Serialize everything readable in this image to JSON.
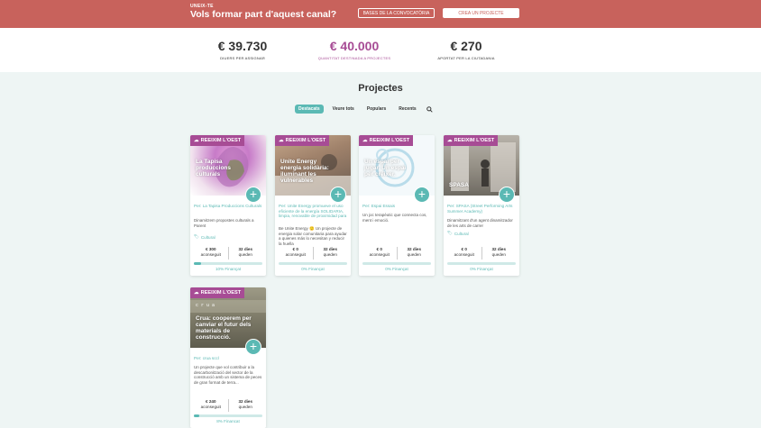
{
  "banner": {
    "eyebrow": "UNEIX-TE",
    "headline": "Vols formar part d'aquest canal?",
    "bases_button": "BASES DE LA CONVOCATÒRIA",
    "create_button": "CREA UN PROJECTE"
  },
  "stats": [
    {
      "value": "€ 39.730",
      "label": "DIUERS PER ASSIGNAR"
    },
    {
      "value": "€ 40.000",
      "label": "QUANTITAT DESTINADA A PROJECTES"
    },
    {
      "value": "€ 270",
      "label": "APORTAT PER LA CIUTADANIA"
    }
  ],
  "colors": {
    "accent": "#5bb9b4",
    "brand_red": "#c8625c",
    "badge_purple": "#a74c95"
  },
  "section_title": "Projectes",
  "tabs": [
    "Destacats",
    "Veure tots",
    "Populars",
    "Recents"
  ],
  "search_icon": "search-icon",
  "cards": [
    {
      "badge": "REEIXIM L'OEST",
      "overlay_title": "La Tapisa produccions culturals",
      "author": "Per: La Tapisa Produccions Culturals",
      "desc": "Dinamitzem propostes culturals a Parent",
      "category": "Cultural",
      "raised": "€ 300",
      "raised_label": "aconseguit",
      "days": "32 dies",
      "days_label": "queden",
      "percent_text": "10% Finançat",
      "percent": 10
    },
    {
      "badge": "REEIXIM L'OEST",
      "overlay_title": "Unite Energy energia solidària: iluminant les vulnerables",
      "author": "Per: Unite Energy promueve el uso eficiente de la energía SOLIDARIA, limpia, renovable de proximidad para",
      "desc": "Be Unite Energy 🙂 Un projecte de energia solar comunitaria para ayudar a quienes más lo necesitan y reducir la huella",
      "category": "",
      "raised": "€ 0",
      "raised_label": "aconseguit",
      "days": "32 dies",
      "days_label": "queden",
      "percent_text": "0% Finançat",
      "percent": 0
    },
    {
      "badge": "REEIXIM L'OEST",
      "overlay_title": "Un espai per jugar. Un espai per créixer.",
      "author": "Per: Espai Essais",
      "desc": "Un joc terapèutic que connecta cos, ment i emoció.",
      "category": "",
      "raised": "€ 0",
      "raised_label": "aconseguit",
      "days": "32 dies",
      "days_label": "queden",
      "percent_text": "0% Finançat",
      "percent": 0
    },
    {
      "badge": "REEIXIM L'OEST",
      "overlay_title": "SPASA",
      "author": "Per: SPASA (Street Performing Arts Summer Academy)",
      "desc": "Dinamitzant d'un agent dinamitzador de les arts de carrer",
      "category": "Cultural",
      "raised": "€ 0",
      "raised_label": "aconseguit",
      "days": "32 dies",
      "days_label": "queden",
      "percent_text": "0% Finançat",
      "percent": 0
    },
    {
      "badge": "REEIXIM L'OEST",
      "overlay_title": "Crua: cooperem per canviar el futur dels materials de construcció.",
      "author": "Per: crua sccl",
      "desc": "Un projecte que vol contribuir a la descarbonització del sector de la construcció amb un sistema de peces de gran format de terra...",
      "category": "",
      "raised": "€ 240",
      "raised_label": "aconseguit",
      "days": "32 dies",
      "days_label": "queden",
      "percent_text": "8% Financat",
      "percent": 8
    }
  ]
}
